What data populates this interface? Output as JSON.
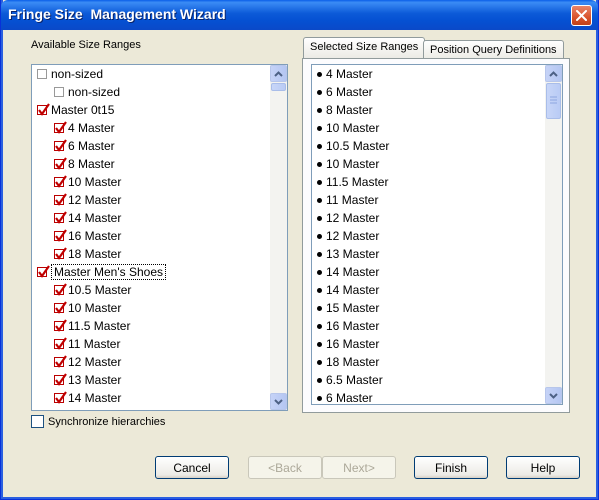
{
  "window": {
    "title": "Fringe Size  Management Wizard"
  },
  "left_panel": {
    "label": "Available Size Ranges",
    "items": [
      {
        "label": "non-sized",
        "checked": false,
        "level": 0
      },
      {
        "label": "non-sized",
        "checked": false,
        "level": 1
      },
      {
        "label": "Master 0t15",
        "checked": true,
        "level": 0
      },
      {
        "label": "4 Master",
        "checked": true,
        "level": 1
      },
      {
        "label": "6 Master",
        "checked": true,
        "level": 1
      },
      {
        "label": "8 Master",
        "checked": true,
        "level": 1
      },
      {
        "label": "10 Master",
        "checked": true,
        "level": 1
      },
      {
        "label": "12 Master",
        "checked": true,
        "level": 1
      },
      {
        "label": "14 Master",
        "checked": true,
        "level": 1
      },
      {
        "label": "16 Master",
        "checked": true,
        "level": 1
      },
      {
        "label": "18 Master",
        "checked": true,
        "level": 1
      },
      {
        "label": "Master Men's Shoes",
        "checked": true,
        "level": 0,
        "focused": true
      },
      {
        "label": "10.5 Master",
        "checked": true,
        "level": 1
      },
      {
        "label": "10 Master",
        "checked": true,
        "level": 1
      },
      {
        "label": "11.5 Master",
        "checked": true,
        "level": 1
      },
      {
        "label": "11 Master",
        "checked": true,
        "level": 1
      },
      {
        "label": "12 Master",
        "checked": true,
        "level": 1
      },
      {
        "label": "13 Master",
        "checked": true,
        "level": 1
      },
      {
        "label": "14 Master",
        "checked": true,
        "level": 1
      }
    ],
    "scroll_position": 0.0
  },
  "tabs": [
    {
      "label": "Selected Size Ranges",
      "active": true
    },
    {
      "label": "Position Query Definitions",
      "active": false
    }
  ],
  "right_panel": {
    "items": [
      "4 Master",
      "6 Master",
      "8 Master",
      "10 Master",
      "10.5 Master",
      "10 Master",
      "11.5 Master",
      "11 Master",
      "12 Master",
      "12 Master",
      "13 Master",
      "14 Master",
      "14 Master",
      "15 Master",
      "16 Master",
      "16 Master",
      "18 Master",
      "6.5 Master",
      "6 Master"
    ],
    "scroll_position": 0.0
  },
  "sync_checkbox": {
    "label": "Synchronize hierarchies",
    "checked": false
  },
  "buttons": {
    "cancel": "Cancel",
    "back": "<Back",
    "next": "Next>",
    "finish": "Finish",
    "help": "Help"
  },
  "colors": {
    "title_bar": "#0a5fe8",
    "check_mark": "#c00000",
    "dialog_bg": "#ece9d8",
    "list_border": "#7f9db9",
    "tab_highlight": "#ffc83c"
  }
}
